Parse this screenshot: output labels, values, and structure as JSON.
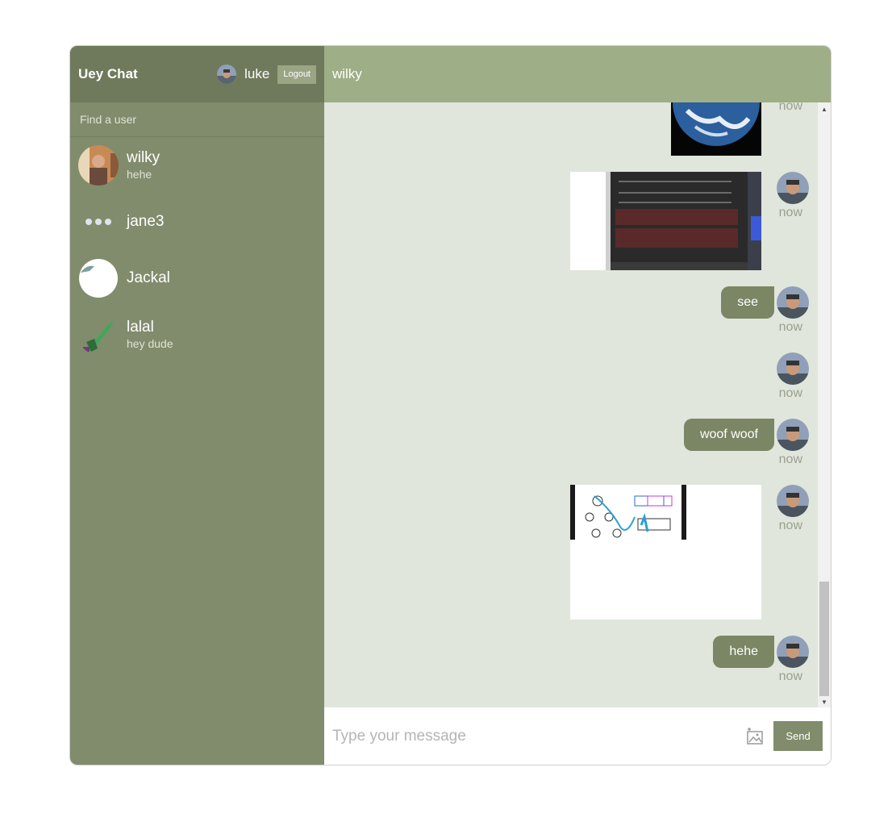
{
  "app": {
    "title": "Uey Chat"
  },
  "current_user": {
    "name": "luke",
    "logout_label": "Logout"
  },
  "search": {
    "placeholder": "Find a user"
  },
  "contacts": [
    {
      "name": "wilky",
      "last_message": "hehe"
    },
    {
      "name": "jane3",
      "last_message": ""
    },
    {
      "name": "Jackal",
      "last_message": ""
    },
    {
      "name": "lalal",
      "last_message": "hey dude"
    }
  ],
  "chat": {
    "title": "wilky",
    "messages": [
      {
        "type": "image",
        "content": "earth photo",
        "time": "now"
      },
      {
        "type": "image",
        "content": "console screenshot",
        "time": "now"
      },
      {
        "type": "text",
        "content": "see",
        "time": "now"
      },
      {
        "type": "empty",
        "content": "",
        "time": "now"
      },
      {
        "type": "text",
        "content": "woof woof",
        "time": "now"
      },
      {
        "type": "image",
        "content": "tree traversal notes",
        "time": "now"
      },
      {
        "type": "text",
        "content": "hehe",
        "time": "now"
      }
    ]
  },
  "composer": {
    "placeholder": "Type your message",
    "send_label": "Send"
  },
  "colors": {
    "sidebar": "#818c6c",
    "navbar": "#6f7a5c",
    "chat_header": "#9eae86",
    "chat_bg": "#e0e6db",
    "bubble": "#7a8664"
  }
}
